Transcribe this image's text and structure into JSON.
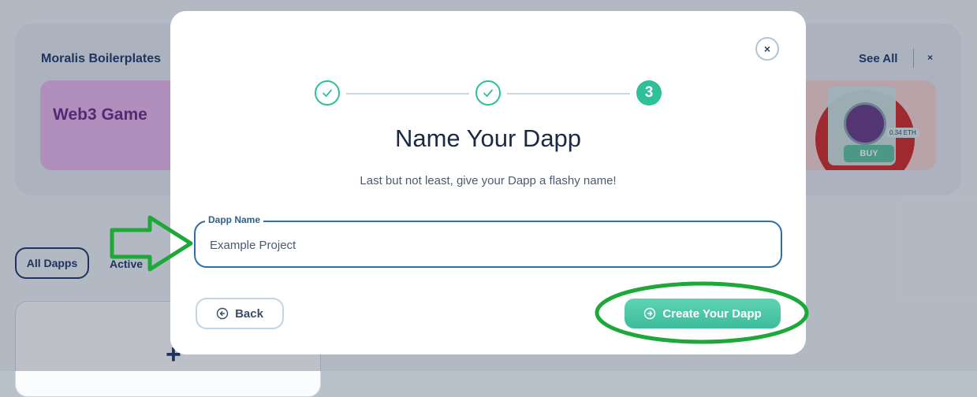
{
  "background": {
    "boilerplates_title": "Moralis Boilerplates",
    "see_all": "See All",
    "close_label": "×",
    "web3_game_tile": "Web3 Game",
    "nft_buy_label": "BUY",
    "nft_price_label": "0.34 ETH",
    "filters": [
      "All Dapps",
      "Active"
    ],
    "add_symbol": "+"
  },
  "modal": {
    "close_label": "×",
    "stepper": {
      "steps": [
        {
          "state": "done"
        },
        {
          "state": "done"
        },
        {
          "state": "current",
          "label": "3"
        }
      ]
    },
    "title": "Name Your Dapp",
    "subtitle": "Last but not least, give your Dapp a flashy name!",
    "field": {
      "label": "Dapp Name",
      "value": "Example Project"
    },
    "back_label": "Back",
    "create_label": "Create Your Dapp"
  },
  "colors": {
    "accent": "#2ebf9b",
    "field_border": "#2f6fa6",
    "annotation": "#1fa83a"
  }
}
